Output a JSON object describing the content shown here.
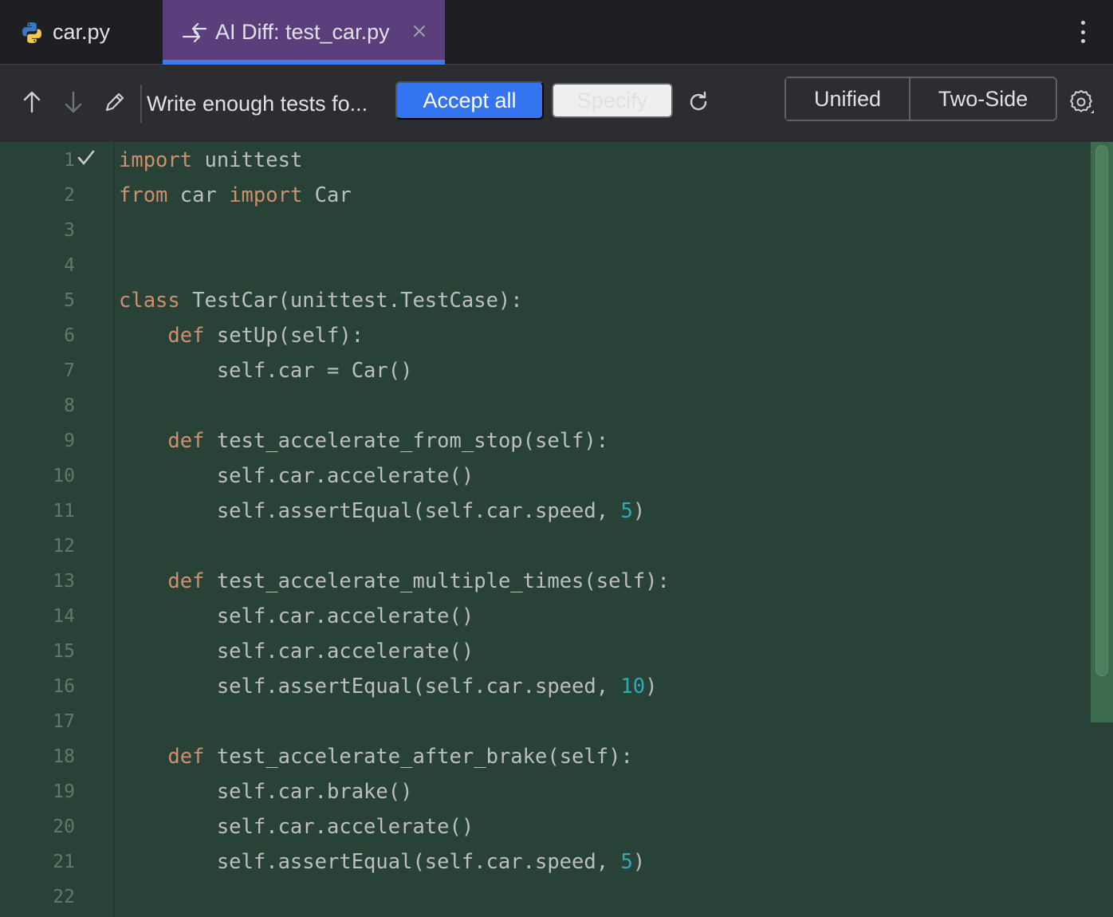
{
  "tabs": [
    {
      "label": "car.py",
      "icon": "python-icon"
    },
    {
      "label": "AI Diff: test_car.py",
      "icon": "diff-icon",
      "active": true
    }
  ],
  "toolbar": {
    "prompt": "Write enough tests fo...",
    "accept_label": "Accept all",
    "specify_label": "Specify",
    "view_modes": [
      "Unified",
      "Two-Side"
    ],
    "selected_view": "Unified"
  },
  "colors": {
    "accent": "#3574f0",
    "active_tab": "#5a3f7c",
    "added_background": "#294237",
    "keyword": "#cf8e6d",
    "number": "#2aacb8"
  },
  "code_lines": [
    {
      "n": "1",
      "segs": [
        {
          "t": "import",
          "c": "kw"
        },
        {
          "t": " unittest"
        }
      ]
    },
    {
      "n": "2",
      "segs": [
        {
          "t": "from",
          "c": "kw"
        },
        {
          "t": " car "
        },
        {
          "t": "import",
          "c": "kw"
        },
        {
          "t": " Car"
        }
      ]
    },
    {
      "n": "3",
      "segs": []
    },
    {
      "n": "4",
      "segs": []
    },
    {
      "n": "5",
      "segs": [
        {
          "t": "class",
          "c": "kw"
        },
        {
          "t": " TestCar(unittest.TestCase):"
        }
      ]
    },
    {
      "n": "6",
      "segs": [
        {
          "t": "    "
        },
        {
          "t": "def",
          "c": "kw"
        },
        {
          "t": " setUp(self):"
        }
      ]
    },
    {
      "n": "7",
      "segs": [
        {
          "t": "        self.car = Car()"
        }
      ]
    },
    {
      "n": "8",
      "segs": []
    },
    {
      "n": "9",
      "segs": [
        {
          "t": "    "
        },
        {
          "t": "def",
          "c": "kw"
        },
        {
          "t": " test_accelerate_from_stop(self):"
        }
      ]
    },
    {
      "n": "10",
      "segs": [
        {
          "t": "        self.car.accelerate()"
        }
      ]
    },
    {
      "n": "11",
      "segs": [
        {
          "t": "        self.assertEqual(self.car.speed, "
        },
        {
          "t": "5",
          "c": "num"
        },
        {
          "t": ")"
        }
      ]
    },
    {
      "n": "12",
      "segs": []
    },
    {
      "n": "13",
      "segs": [
        {
          "t": "    "
        },
        {
          "t": "def",
          "c": "kw"
        },
        {
          "t": " test_accelerate_multiple_times(self):"
        }
      ]
    },
    {
      "n": "14",
      "segs": [
        {
          "t": "        self.car.accelerate()"
        }
      ]
    },
    {
      "n": "15",
      "segs": [
        {
          "t": "        self.car.accelerate()"
        }
      ]
    },
    {
      "n": "16",
      "segs": [
        {
          "t": "        self.assertEqual(self.car.speed, "
        },
        {
          "t": "10",
          "c": "num"
        },
        {
          "t": ")"
        }
      ]
    },
    {
      "n": "17",
      "segs": []
    },
    {
      "n": "18",
      "segs": [
        {
          "t": "    "
        },
        {
          "t": "def",
          "c": "kw"
        },
        {
          "t": " test_accelerate_after_brake(self):"
        }
      ]
    },
    {
      "n": "19",
      "segs": [
        {
          "t": "        self.car.brake()"
        }
      ]
    },
    {
      "n": "20",
      "segs": [
        {
          "t": "        self.car.accelerate()"
        }
      ]
    },
    {
      "n": "21",
      "segs": [
        {
          "t": "        self.assertEqual(self.car.speed, "
        },
        {
          "t": "5",
          "c": "num"
        },
        {
          "t": ")"
        }
      ]
    },
    {
      "n": "22",
      "segs": []
    }
  ]
}
